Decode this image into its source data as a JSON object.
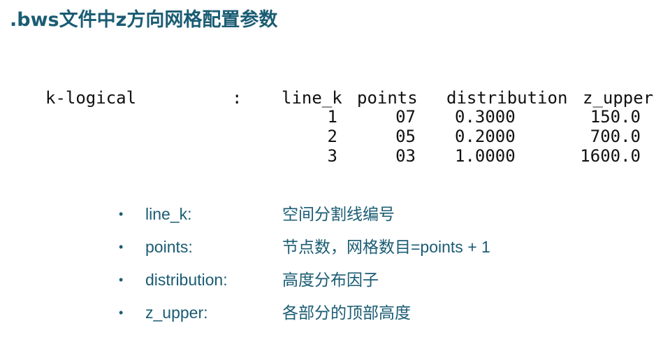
{
  "slide": {
    "title": ".bws文件中z方向网格配置参数"
  },
  "config_table": {
    "row_label": "k-logical",
    "separator": ":",
    "columns": [
      "line_k",
      "points",
      "distribution",
      "z_upper"
    ],
    "rows": [
      {
        "line_k": "1",
        "points": "07",
        "distribution": "0.3000",
        "z_upper": "150.0"
      },
      {
        "line_k": "2",
        "points": "05",
        "distribution": "0.2000",
        "z_upper": "700.0"
      },
      {
        "line_k": "3",
        "points": "03",
        "distribution": "1.0000",
        "z_upper": "1600.0"
      }
    ]
  },
  "definitions": [
    {
      "bullet": "•",
      "term": "line_k:",
      "description": "空间分割线编号"
    },
    {
      "bullet": "•",
      "term": "points:",
      "description": "节点数，网格数目=points + 1"
    },
    {
      "bullet": "•",
      "term": "distribution:",
      "description": "高度分布因子"
    },
    {
      "bullet": "•",
      "term": "z_upper:",
      "description": "各部分的顶部高度"
    }
  ],
  "colors": {
    "title": "#1a5c73",
    "bullet_text": "#1a5c73",
    "table_text": "#111111",
    "background": "#ffffff"
  }
}
